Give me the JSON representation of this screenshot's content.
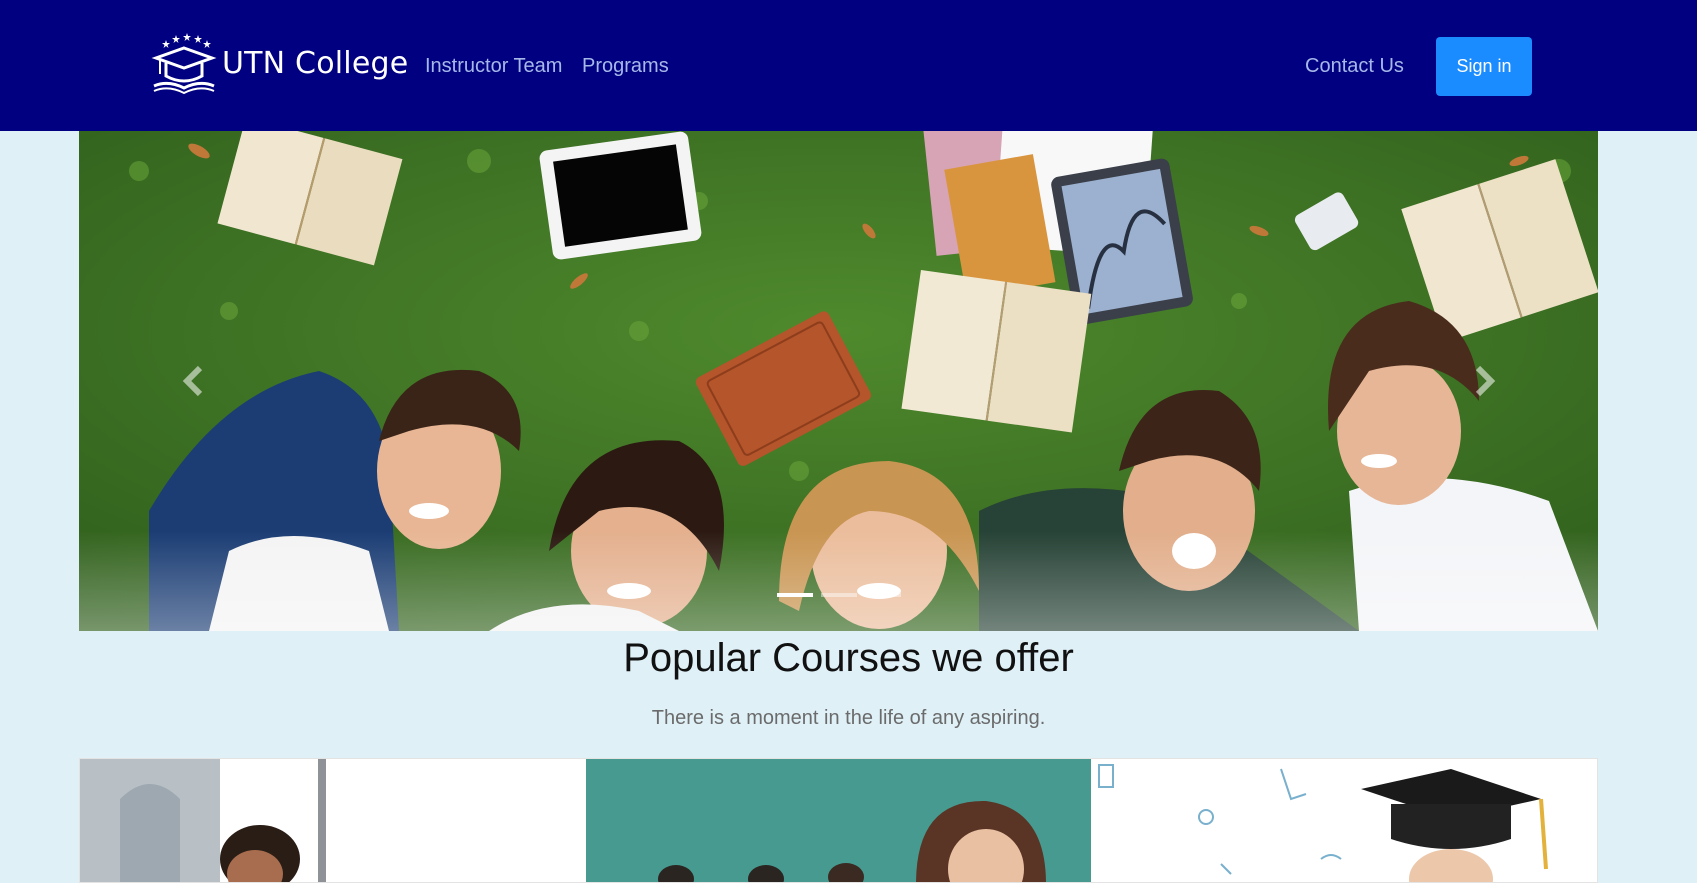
{
  "brand": {
    "name": "UTN College",
    "logo_icon": "graduation-cap-book-icon"
  },
  "nav": {
    "links": [
      {
        "label": "Instructor Team"
      },
      {
        "label": "Programs"
      },
      {
        "label": "Contact Us"
      }
    ],
    "signin_label": "Sign in"
  },
  "colors": {
    "navbar_bg": "#000080",
    "page_bg": "#dff0f7",
    "signin_bg": "#1a8cff",
    "nav_link": "#a6b8e8"
  },
  "carousel": {
    "prev_icon": "chevron-left-icon",
    "next_icon": "chevron-right-icon",
    "slide_count": 3,
    "active_slide": 1
  },
  "courses_section": {
    "title": "Popular Courses we offer",
    "subtitle": "There is a moment in the life of any aspiring."
  }
}
